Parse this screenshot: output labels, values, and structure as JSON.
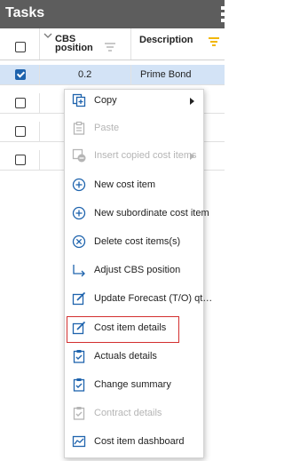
{
  "panel": {
    "title": "Tasks"
  },
  "grid": {
    "columns": [
      {
        "key": "cbs_position",
        "label_line1": "CBS",
        "label_line2": "position"
      },
      {
        "key": "description",
        "label": "Description"
      }
    ],
    "rows": [
      {
        "checked": true,
        "cbs_position": "0.2",
        "description": "Prime Bond",
        "selected": true
      },
      {
        "checked": false,
        "cbs_position": "",
        "description": "",
        "selected": false
      },
      {
        "checked": false,
        "cbs_position": "",
        "description": "",
        "selected": false
      },
      {
        "checked": false,
        "cbs_position": "",
        "description": "",
        "selected": false
      }
    ],
    "filter_active_color": "#f2b705"
  },
  "context_menu": {
    "items": [
      {
        "label": "Copy",
        "icon": "copy-icon",
        "enabled": true,
        "submenu": true
      },
      {
        "label": "Paste",
        "icon": "paste-icon",
        "enabled": false,
        "submenu": false
      },
      {
        "label": "Insert copied cost items",
        "icon": "insert-copied-icon",
        "enabled": false,
        "submenu": true
      },
      {
        "label": "New cost item",
        "icon": "plus-circle-icon",
        "enabled": true,
        "submenu": false
      },
      {
        "label": "New subordinate cost item",
        "icon": "plus-circle-icon",
        "enabled": true,
        "submenu": false
      },
      {
        "label": "Delete cost items(s)",
        "icon": "x-circle-icon",
        "enabled": true,
        "submenu": false
      },
      {
        "label": "Adjust CBS position",
        "icon": "adjust-arrow-icon",
        "enabled": true,
        "submenu": false
      },
      {
        "label": "Update Forecast (T/O) qt…",
        "icon": "edit-icon",
        "enabled": true,
        "submenu": false
      },
      {
        "label": "Cost item details",
        "icon": "edit-icon",
        "enabled": true,
        "submenu": false,
        "highlighted": true
      },
      {
        "label": "Actuals details",
        "icon": "clipboard-check-icon",
        "enabled": true,
        "submenu": false
      },
      {
        "label": "Change summary",
        "icon": "clipboard-check-icon",
        "enabled": true,
        "submenu": false
      },
      {
        "label": "Contract details",
        "icon": "clipboard-check-icon",
        "enabled": false,
        "submenu": false
      },
      {
        "label": "Cost item dashboard",
        "icon": "dashboard-chart-icon",
        "enabled": true,
        "submenu": false
      }
    ],
    "highlight_color": "#d32f2f"
  },
  "colors": {
    "accent": "#1e63ad",
    "title_bar": "#5d5d5d",
    "selected_row": "#d3e3f6",
    "disabled_text": "#b5b5b5"
  }
}
